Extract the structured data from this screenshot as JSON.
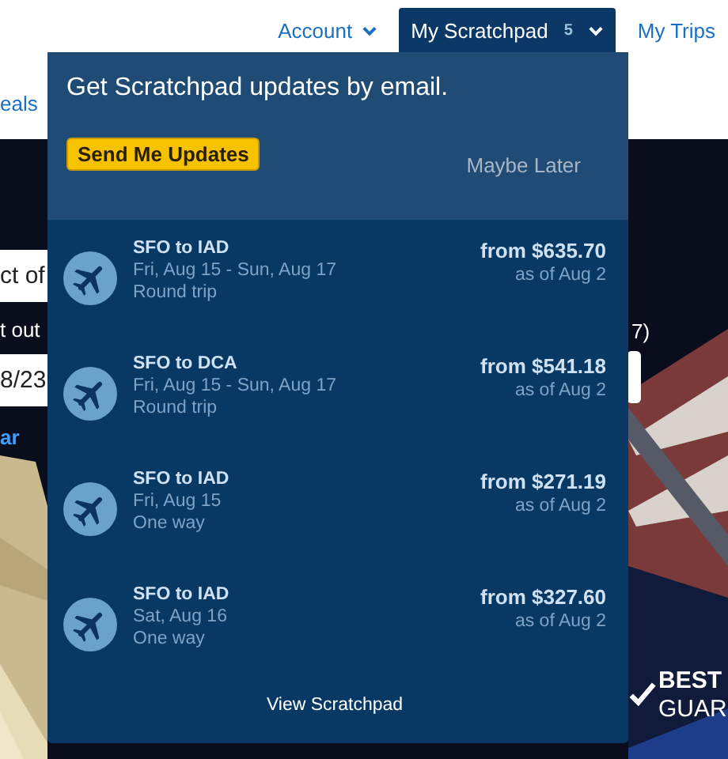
{
  "nav": [
    {
      "label": "Account",
      "selected": false,
      "dropdown": true
    },
    {
      "label": "My Scratchpad",
      "count": "5",
      "selected": true,
      "dropdown": true
    },
    {
      "label": "My Trips",
      "selected": false,
      "dropdown": false
    }
  ],
  "secondary_nav": {
    "label": "eals"
  },
  "background_form": {
    "field_1": "ct of",
    "label_1": "t out",
    "field_2": "8/23",
    "link": "ar",
    "label_2": "7)",
    "badge_line_1": "BEST",
    "badge_line_2": "GUAR"
  },
  "scratchpad": {
    "heading": "Get Scratchpad updates by email.",
    "subscribe_button": "Send Me Updates",
    "dismiss_link": "Maybe Later",
    "trips": [
      {
        "route": "SFO to IAD",
        "dates": "Fri, Aug 15 - Sun, Aug 17",
        "trip_type": "Round trip",
        "price": "from $635.70",
        "as_of": "as of Aug 2"
      },
      {
        "route": "SFO to DCA",
        "dates": "Fri, Aug 15 - Sun, Aug 17",
        "trip_type": "Round trip",
        "price": "from $541.18",
        "as_of": "as of Aug 2"
      },
      {
        "route": "SFO to IAD",
        "dates": "Fri, Aug 15",
        "trip_type": "One way",
        "price": "from $271.19",
        "as_of": "as of Aug 2"
      },
      {
        "route": "SFO to IAD",
        "dates": "Sat, Aug 16",
        "trip_type": "One way",
        "price": "from $327.60",
        "as_of": "as of Aug 2"
      }
    ],
    "footer_link": "View Scratchpad"
  }
}
